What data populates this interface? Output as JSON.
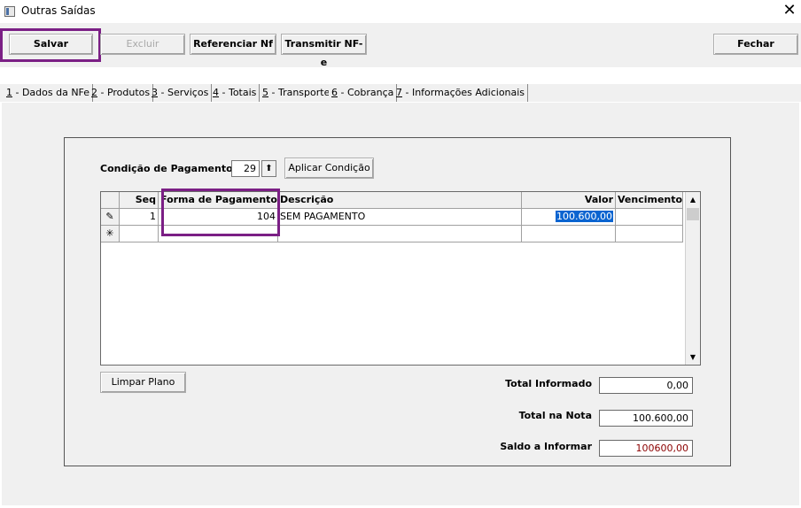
{
  "window": {
    "title": "Outras Saídas",
    "close_glyph": "✕"
  },
  "toolbar": {
    "salvar": "Salvar",
    "excluir": "Excluir",
    "referenciar": "Referenciar Nf",
    "transmitir": "Transmitir NF-e",
    "fechar": "Fechar"
  },
  "tabs": [
    {
      "key": "1",
      "label": " - Dados da NFe"
    },
    {
      "key": "2",
      "label": " - Produtos"
    },
    {
      "key": "3",
      "label": " - Serviços"
    },
    {
      "key": "4",
      "label": " - Totais"
    },
    {
      "key": "5",
      "label": " - Transporte"
    },
    {
      "key": "6",
      "label": " - Cobrança"
    },
    {
      "key": "7",
      "label": " - Informações Adicionais"
    }
  ],
  "payment": {
    "condicao_label": "Condição de Pagamento",
    "condicao_value": "29",
    "aplicar_button": "Aplicar Condição",
    "limpar_button": "Limpar Plano"
  },
  "grid": {
    "columns": [
      "Seq",
      "Forma de Pagamento",
      "Descrição",
      "Valor",
      "Vencimento"
    ],
    "rows": [
      {
        "indicator": "✎",
        "seq": "1",
        "forma": "104",
        "descricao": "SEM PAGAMENTO",
        "valor": "100.600,00",
        "vencimento": ""
      },
      {
        "indicator": "✳",
        "seq": "",
        "forma": "",
        "descricao": "",
        "valor": "",
        "vencimento": ""
      }
    ]
  },
  "totals": {
    "informado_label": "Total Informado",
    "informado_value": "0,00",
    "nota_label": "Total na Nota",
    "nota_value": "100.600,00",
    "saldo_label": "Saldo a Informar",
    "saldo_value": "100600,00",
    "saldo_color": "#8b0000"
  },
  "colors": {
    "highlight": "#7b1f85",
    "selection": "#0a64d0"
  }
}
